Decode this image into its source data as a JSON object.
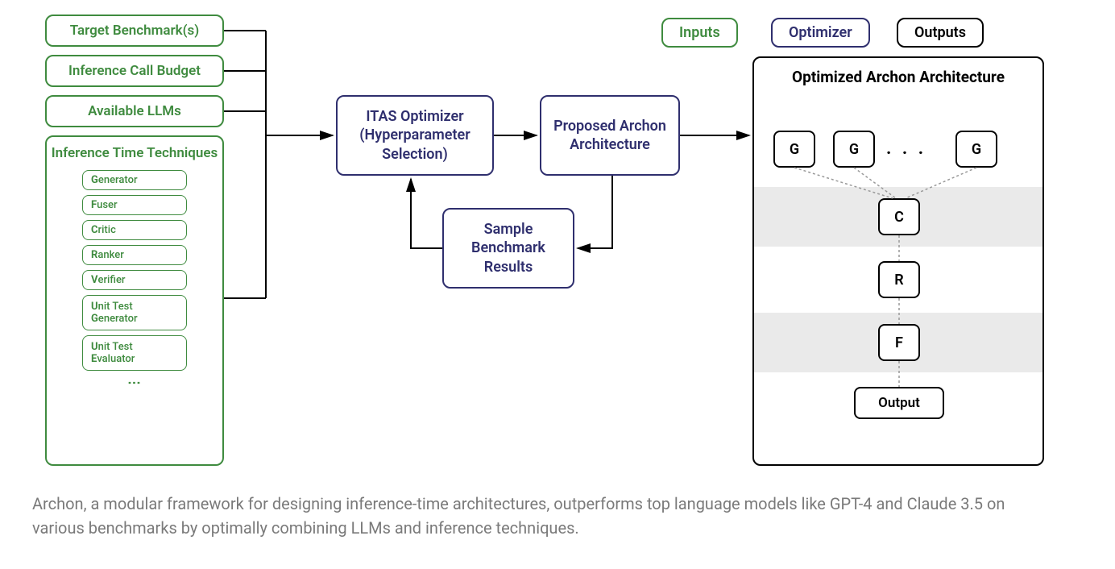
{
  "legend": {
    "inputs": "Inputs",
    "optimizer": "Optimizer",
    "outputs": "Outputs"
  },
  "inputs": {
    "targetBenchmarks": "Target Benchmark(s)",
    "inferenceBudget": "Inference Call Budget",
    "availableLLMs": "Available LLMs",
    "techniquesTitle": "Inference Time Techniques",
    "techniques": {
      "generator": {
        "bold": "G",
        "rest": "enerator"
      },
      "fuser": {
        "bold": "F",
        "rest": "user"
      },
      "critic": {
        "bold": "C",
        "rest": "ritic"
      },
      "ranker": {
        "bold": "R",
        "rest": "anker"
      },
      "verifier": {
        "bold": "V",
        "rest": "erifier"
      },
      "utg": {
        "bold1": "U",
        "rest1": "nit Test",
        "bold2": "G",
        "rest2": "enerator"
      },
      "ute": {
        "bold1": "U",
        "rest1": "nit Test",
        "bold2": "E",
        "rest2": "valuator"
      }
    }
  },
  "optimizer": {
    "itas": "ITAS Optimizer (Hyperparameter Selection)",
    "proposed": "Proposed Archon Architecture",
    "sample": "Sample Benchmark Results"
  },
  "outputs": {
    "title": "Optimized Archon Architecture",
    "g": "G",
    "dots": ". . .",
    "c": "C",
    "r": "R",
    "f": "F",
    "output": "Output"
  },
  "caption": "Archon, a modular framework for designing inference-time architectures, outperforms top language models like GPT-4 and Claude 3.5 on various benchmarks by optimally combining LLMs and inference techniques."
}
